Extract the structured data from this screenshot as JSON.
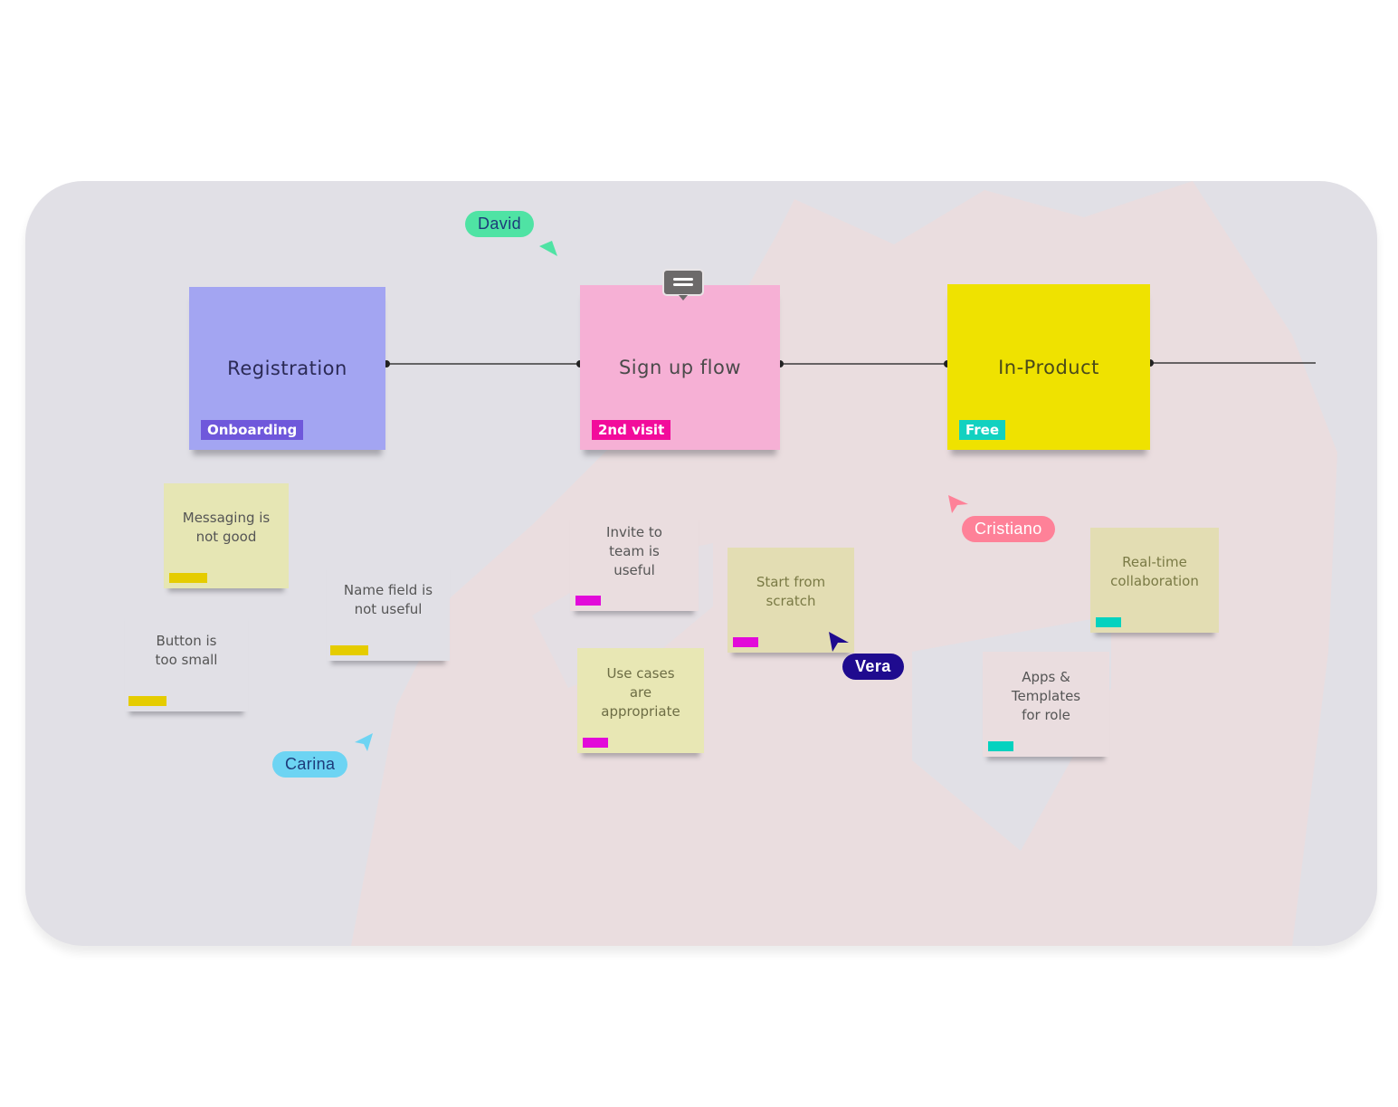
{
  "board": {
    "background_color": "#e1e0e6",
    "accent_background_color": "#eadddf"
  },
  "frames": [
    {
      "id": "registration",
      "title": "Registration",
      "tag": "Onboarding",
      "color": "#a3a5f2",
      "tag_color": "#6f58db",
      "text_color": "#2b2a55"
    },
    {
      "id": "signup",
      "title": "Sign up flow",
      "tag": "2nd visit",
      "color": "#f6b0d5",
      "tag_color": "#f20c9b",
      "text_color": "#4a4a4a",
      "has_comment": true
    },
    {
      "id": "inproduct",
      "title": "In-Product",
      "tag": "Free",
      "color": "#efe200",
      "tag_color": "#12d1c0",
      "text_color": "#4a4a1a"
    }
  ],
  "notes": [
    {
      "text_lines": [
        "Messaging is",
        "not good"
      ],
      "bg": "#e6e6b4",
      "chip": "#e5cc00"
    },
    {
      "text_lines": [
        "Button is",
        "too small"
      ],
      "bg": "#e1e0e6",
      "chip": "#e5cc00"
    },
    {
      "text_lines": [
        "Name field is",
        "not useful"
      ],
      "bg": "#e1e0e6",
      "chip": "#e5cc00"
    },
    {
      "text_lines": [
        "Invite to",
        "team is",
        "useful"
      ],
      "bg": "#eadddf",
      "chip": "#e20ad9"
    },
    {
      "text_lines": [
        "Start from",
        "scratch"
      ],
      "bg": "#e3ddb3",
      "chip": "#e20ad9"
    },
    {
      "text_lines": [
        "Use cases",
        "are",
        "appropriate"
      ],
      "bg": "#e8e7b4",
      "chip": "#e20ad9"
    },
    {
      "text_lines": [
        "Real-time",
        "collaboration"
      ],
      "bg": "#e3ddb3",
      "chip": "#04d2bf"
    },
    {
      "text_lines": [
        "Apps  &",
        "Templates",
        "for role"
      ],
      "bg": "#eadddf",
      "chip": "#04d2bf"
    }
  ],
  "collaborators": [
    {
      "name": "David",
      "color": "#4fe3a4",
      "text_color": "#1d3b7a"
    },
    {
      "name": "Carina",
      "color": "#6dd4f3",
      "text_color": "#1d3b7a"
    },
    {
      "name": "Vera",
      "color": "#1f0b8f",
      "text_color": "#ffffff"
    },
    {
      "name": "Cristiano",
      "color": "#fe8198",
      "text_color": "#ffffff"
    }
  ],
  "icons": {
    "comment": "comment-bubble-icon",
    "cursor": "arrow-cursor-icon"
  }
}
